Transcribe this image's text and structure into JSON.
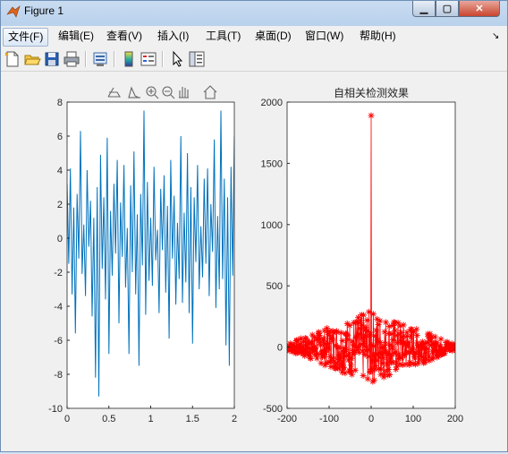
{
  "window": {
    "title": "Figure 1"
  },
  "menu": [
    {
      "label": "文件(F)"
    },
    {
      "label": "编辑(E)"
    },
    {
      "label": "查看(V)"
    },
    {
      "label": "插入(I)"
    },
    {
      "label": "工具(T)"
    },
    {
      "label": "桌面(D)"
    },
    {
      "label": "窗口(W)"
    },
    {
      "label": "帮助(H)"
    }
  ],
  "toolbar_icons": [
    "new-figure-icon",
    "open-file-icon",
    "save-icon",
    "print-icon",
    "print-preview-icon",
    "colorbar-icon",
    "legend-icon",
    "pointer-icon",
    "property-inspector-icon"
  ],
  "axes_toolbar_icons": [
    "brush-icon",
    "data-tip-icon",
    "zoom-in-icon",
    "zoom-out-icon",
    "pan-icon",
    "home-icon"
  ],
  "colors": {
    "line_blue": "#0072bd",
    "marker_red": "#ff0000"
  },
  "chart_data": [
    {
      "type": "line",
      "title": "",
      "xlim": [
        0,
        2
      ],
      "ylim": [
        -10,
        8
      ],
      "xticks": [
        "0",
        "0.5",
        "1",
        "1.5",
        "2"
      ],
      "yticks": [
        "-10",
        "-8",
        "-6",
        "-4",
        "-2",
        "0",
        "2",
        "4",
        "6",
        "8"
      ],
      "grid": false,
      "series": [
        {
          "color": "#0072bd",
          "x": [
            0,
            0.02,
            0.04,
            0.06,
            0.08,
            0.1,
            0.12,
            0.14,
            0.16,
            0.18,
            0.2,
            0.22,
            0.24,
            0.26,
            0.28,
            0.3,
            0.32,
            0.34,
            0.36,
            0.38,
            0.4,
            0.42,
            0.44,
            0.46,
            0.48,
            0.5,
            0.52,
            0.54,
            0.56,
            0.58,
            0.6,
            0.62,
            0.64,
            0.66,
            0.68,
            0.7,
            0.72,
            0.74,
            0.76,
            0.78,
            0.8,
            0.82,
            0.84,
            0.86,
            0.88,
            0.9,
            0.92,
            0.94,
            0.96,
            0.98,
            1,
            1.02,
            1.04,
            1.06,
            1.08,
            1.1,
            1.12,
            1.14,
            1.16,
            1.18,
            1.2,
            1.22,
            1.24,
            1.26,
            1.28,
            1.3,
            1.32,
            1.34,
            1.36,
            1.38,
            1.4,
            1.42,
            1.44,
            1.46,
            1.48,
            1.5,
            1.52,
            1.54,
            1.56,
            1.58,
            1.6,
            1.62,
            1.64,
            1.66,
            1.68,
            1.7,
            1.72,
            1.74,
            1.76,
            1.78,
            1.8,
            1.82,
            1.84,
            1.86,
            1.88,
            1.9,
            1.92,
            1.94,
            1.96,
            1.98,
            2
          ],
          "y": [
            3.2,
            -1.5,
            4.1,
            -3.3,
            1.8,
            -5.6,
            2.6,
            -1.2,
            6.3,
            -2.1,
            0.8,
            -3.4,
            4.0,
            -0.5,
            2.2,
            -4.6,
            1.2,
            -8.2,
            3.0,
            -9.3,
            4.9,
            -1.8,
            2.4,
            -3.6,
            5.9,
            -6.8,
            1.6,
            -2.2,
            3.2,
            -0.9,
            4.6,
            -5.0,
            2.1,
            -1.1,
            4.3,
            -2.9,
            0.6,
            -6.8,
            3.1,
            -2.0,
            5.1,
            -3.3,
            1.4,
            -7.5,
            2.6,
            -1.6,
            7.5,
            -4.5,
            3.3,
            -2.5,
            1.2,
            -2.8,
            4.2,
            -1.3,
            0.5,
            -4.4,
            2.9,
            -0.7,
            3.7,
            -3.2,
            1.9,
            -5.9,
            4.6,
            -1.2,
            2.5,
            -3.9,
            0.9,
            -2.4,
            6.0,
            -3.8,
            1.5,
            -2.6,
            5.0,
            -4.4,
            3.0,
            -6.2,
            2.4,
            -1.4,
            4.3,
            -3.0,
            0.7,
            -2.3,
            3.5,
            -1.5,
            4.1,
            -3.4,
            2.0,
            -0.8,
            5.8,
            -4.1,
            1.3,
            -3.0,
            7.5,
            -2.4,
            3.5,
            -6.3,
            2.4,
            -7.5,
            4.2,
            -2.2,
            6.0
          ]
        }
      ]
    },
    {
      "type": "scatter",
      "title": "自相关检测效果",
      "xlim": [
        -200,
        200
      ],
      "ylim": [
        -500,
        2000
      ],
      "xticks": [
        "-200",
        "-100",
        "0",
        "100",
        "200"
      ],
      "yticks": [
        "-500",
        "0",
        "500",
        "1000",
        "1500",
        "2000"
      ],
      "grid": false,
      "series": [
        {
          "color": "#ff0000",
          "marker": "*",
          "peak": {
            "x": 0,
            "y": 1890
          },
          "lag_range": [
            -200,
            200
          ],
          "noise_amplitude_approx": 300
        }
      ]
    }
  ]
}
